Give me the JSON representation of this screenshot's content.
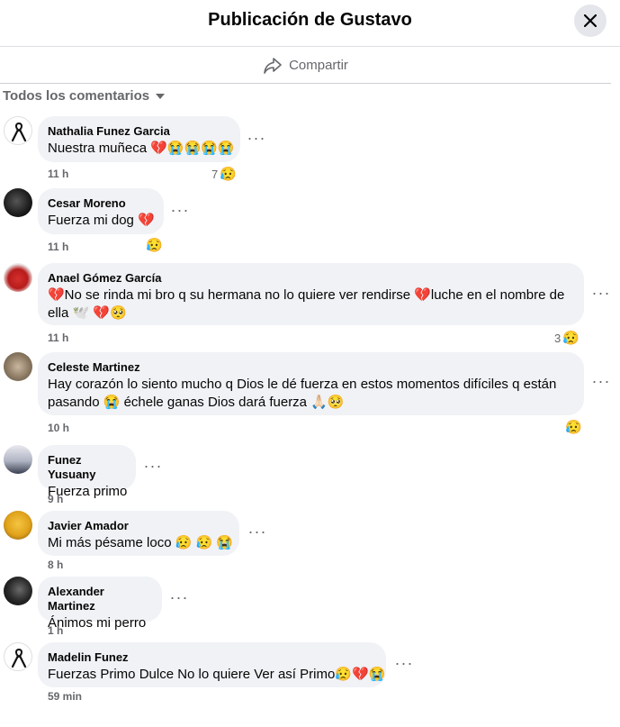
{
  "header": {
    "title": "Publicación de Gustavo"
  },
  "share": {
    "label": "Compartir"
  },
  "filter": {
    "label": "Todos los comentarios"
  },
  "comments": [
    {
      "author": "Nathalia Funez Garcia",
      "text": "Nuestra muñeca 💔😭😭😭😭",
      "time": "11 h",
      "reaction_count": "7",
      "reaction": "😥"
    },
    {
      "author": "Cesar Moreno",
      "text": "Fuerza mi dog 💔",
      "time": "11 h",
      "reaction_count": "",
      "reaction": "😥"
    },
    {
      "author": "Anael Gómez García",
      "text": "💔No se rinda mi bro q su hermana no lo quiere ver rendirse 💔luche en el nombre de ella 🕊️ 💔🥺",
      "time": "11 h",
      "reaction_count": "3",
      "reaction": "😥"
    },
    {
      "author": "Celeste Martinez",
      "text": "Hay corazón lo siento mucho q Dios le dé fuerza en estos momentos difíciles q están pasando 😭 échele ganas Dios dará fuerza 🙏🏻🥺",
      "time": "10 h",
      "reaction_count": "",
      "reaction": "😥"
    },
    {
      "author": "Funez Yusuany",
      "text": "Fuerza primo",
      "time": "9 h"
    },
    {
      "author": "Javier Amador",
      "text": "Mi más pésame loco 😥 😥 😭",
      "time": "8 h"
    },
    {
      "author": "Alexander Martinez",
      "text": "Ánimos mi perro",
      "time": "1 h"
    },
    {
      "author": "Madelin Funez",
      "text": "Fuerzas Primo Dulce No lo quiere Ver así Primo😥💔😭",
      "time": "59 min"
    }
  ]
}
